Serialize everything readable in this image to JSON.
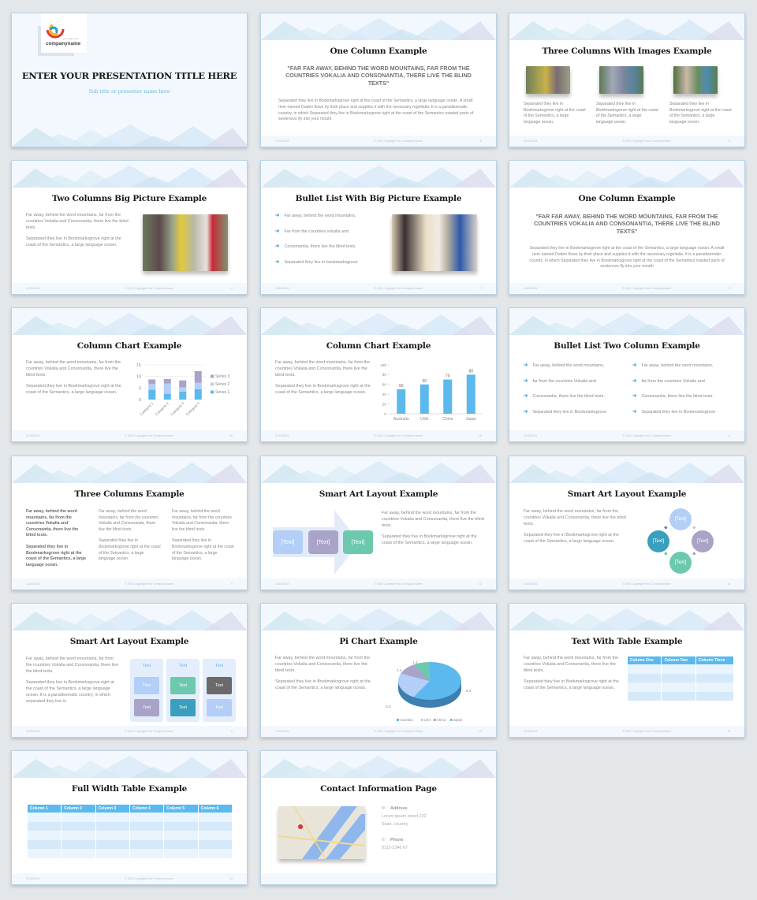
{
  "footer": {
    "date": "11/18/2014",
    "copyright": "© 2014 Copyright Your Company Name"
  },
  "lorem": {
    "far_away": "Far away, behind the word mountains, far from the countries Vokalia and Consonantia, there live the blind texts.",
    "separated": "Separated they live in Bookmarksgrove right at the coast of the Semantics, a large language ocean.",
    "quote": "\"FAR FAR AWAY, BEHIND THE WORD MOUNTAINS, FAR FROM THE COUNTRIES VOKALIA AND CONSONANTIA, THERE LIVE THE BLIND TEXTS\"",
    "long_para": "Separated they live in Bookmarksgrove right at the coast of the Semantics, a large language ocean. A small river named Duden flows by their place and supplies it with the necessary regelialia. It is a paradisematic country, in which Separated they live in Bookmarksgrove right at the coast of the Semantics roasted parts of sentences fly into your mouth",
    "col_text": "Separated they live in Bookmarksgrove right at the coast of the Semantics, a large language ocean.",
    "separated_long": "Separated they live in Bookmarksgrove right at the coast of the Semantics, a large language ocean. It is a paradisematic country, in which separated they live in."
  },
  "slides": {
    "s1": {
      "logo_text": "companyname",
      "logo_tagline": "your slogan here",
      "title": "ENTER YOUR PRESENTATION TITLE HERE",
      "subtitle": "Sub title or presenter name here"
    },
    "s2": {
      "title": "One Column Example",
      "page": "5"
    },
    "s3": {
      "title": "Three Columns With Images Example",
      "page": "6"
    },
    "s4": {
      "title": "Two Columns Big Picture Example",
      "page": "4"
    },
    "s5": {
      "title": "Bullet List With Big Picture Example",
      "page": "7",
      "bullets": [
        "Far away, behind the word mountains,",
        "Far from the countries vokalia and",
        "Consonantia, there live the blind texts.",
        "Separated they live in bookmarksgrove"
      ]
    },
    "s6": {
      "title": "One Column Example",
      "page": "3"
    },
    "s7": {
      "title": "Column Chart Example",
      "page": "16"
    },
    "s8": {
      "title": "Column Chart Example",
      "page": "15"
    },
    "s9": {
      "title": "Bullet List Two Column Example",
      "page": "8",
      "bullets": [
        "Far away, behind the word mountains,",
        "far from the countries Vokalia and",
        "Consonantia, there live the blind texts.",
        "Separated they live in Bookmarksgrove"
      ]
    },
    "s10": {
      "title": "Three Columns Example",
      "page": "9",
      "col_a": "Far away, behind the word mountains, far from the countries Vokalia and Consonantia, there live the blind texts."
    },
    "s11": {
      "title": "Smart Art Layout Example",
      "page": "11",
      "boxes": [
        "[Text]",
        "[Text]",
        "[Text]"
      ]
    },
    "s12": {
      "title": "Smart Art Layout Example",
      "page": "10",
      "circles": [
        "[Text]",
        "[Text]",
        "[Text]",
        "[Text]"
      ]
    },
    "s13": {
      "title": "Smart Art Layout Example",
      "page": "9",
      "header": "Text",
      "cell": "Text"
    },
    "s14": {
      "title": "Pi Chart Example",
      "page": "12"
    },
    "s15": {
      "title": "Text With Table Example",
      "page": "13",
      "columns": [
        "Column One",
        "Column Two",
        "Column Three"
      ]
    },
    "s16": {
      "title": "Full Width Table Example",
      "page": "14",
      "columns": [
        "Column 1",
        "Column 2",
        "Column 3",
        "Column 4",
        "Column 5",
        "Column 6"
      ]
    },
    "s17": {
      "title": "Contact Information Page",
      "address_label": "Address",
      "address_line1": "Lorum ipsum street 232",
      "address_line2": "State, country",
      "phone_label": "Phone",
      "phone": "0112-2346 67"
    }
  },
  "colors": {
    "accent": "#5bb9ed",
    "purple": "#a9a3c8",
    "teal": "#6dc9ad",
    "light_blue": "#b3cff7",
    "dark_teal": "#3a9fbf"
  },
  "chart_data": [
    {
      "type": "bar",
      "stacked": true,
      "title": "",
      "categories": [
        "Category 1",
        "Category 2",
        "Category 3",
        "Category 4"
      ],
      "series": [
        {
          "name": "Series 1",
          "values": [
            4.3,
            2.5,
            3.5,
            4.5
          ],
          "color": "#5bb9ed"
        },
        {
          "name": "Series 2",
          "values": [
            2.4,
            4.4,
            1.8,
            2.8
          ],
          "color": "#b3cff7"
        },
        {
          "name": "Series 3",
          "values": [
            2,
            2,
            3,
            5
          ],
          "color": "#a9a3c8"
        }
      ],
      "ylim": [
        0,
        15
      ],
      "yticks": [
        0,
        5,
        10,
        15
      ],
      "legend": "right",
      "grid": true
    },
    {
      "type": "bar",
      "title": "",
      "categories": [
        "Australia",
        "USA",
        "China",
        "Japan"
      ],
      "values": [
        50,
        60,
        70,
        80
      ],
      "ylim": [
        0,
        100
      ],
      "yticks": [
        0,
        20,
        40,
        60,
        80,
        100
      ],
      "data_labels": true,
      "color": "#5bb9ed"
    },
    {
      "type": "pie",
      "title": "",
      "labels": [
        "Australia",
        "USA",
        "China",
        "Japan"
      ],
      "values": [
        8.2,
        3.2,
        1.4,
        1.2
      ],
      "colors": [
        "#5bb9ed",
        "#b3cff7",
        "#a9a3c8",
        "#6dc9ad"
      ],
      "legend": "bottom"
    }
  ]
}
